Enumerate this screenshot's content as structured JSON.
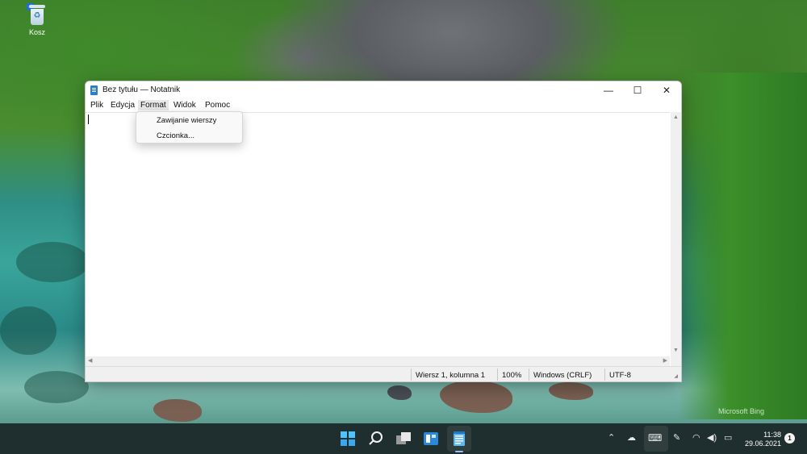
{
  "desktop": {
    "icons": [
      {
        "label": "Kosz",
        "icon": "recycle-bin-icon"
      }
    ],
    "watermark": "Microsoft Bing"
  },
  "window": {
    "title": "Bez tytułu — Notatnik",
    "controls": {
      "minimize": "—",
      "maximize": "☐",
      "close": "✕"
    },
    "menu": [
      {
        "label": "Plik"
      },
      {
        "label": "Edycja"
      },
      {
        "label": "Format",
        "open": true
      },
      {
        "label": "Widok"
      },
      {
        "label": "Pomoc"
      }
    ],
    "format_menu": [
      {
        "label": "Zawijanie wierszy"
      },
      {
        "label": "Czcionka..."
      }
    ],
    "editor": {
      "content": ""
    },
    "status": {
      "position": "Wiersz 1, kolumna 1",
      "zoom": "100%",
      "line_endings": "Windows (CRLF)",
      "encoding": "UTF-8"
    }
  },
  "taskbar": {
    "apps": [
      "start-icon",
      "search-icon",
      "task-view-icon",
      "widgets-icon",
      "notepad-icon"
    ],
    "tray_icons": [
      "chevron-up-icon",
      "onedrive-icon",
      "keyboard-icon",
      "pen-icon",
      "wifi-icon",
      "volume-icon",
      "battery-icon"
    ],
    "time": "11:38",
    "date": "29.06.2021",
    "notification_count": "1"
  },
  "colors": {
    "accent": "#1d6fd6",
    "taskbar": "#1f2e2e",
    "status_bar": "#f0f0f0"
  }
}
